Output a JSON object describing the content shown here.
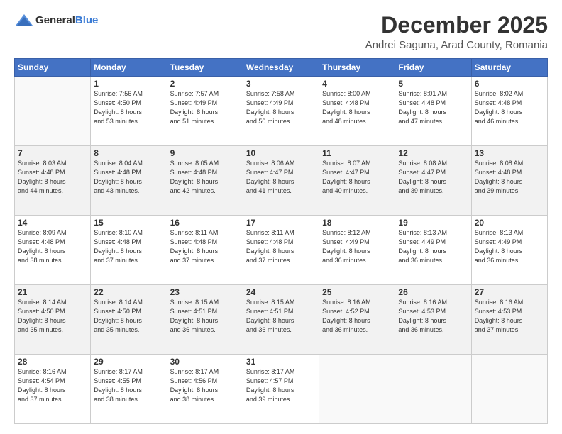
{
  "logo": {
    "general": "General",
    "blue": "Blue"
  },
  "title": "December 2025",
  "subtitle": "Andrei Saguna, Arad County, Romania",
  "header_days": [
    "Sunday",
    "Monday",
    "Tuesday",
    "Wednesday",
    "Thursday",
    "Friday",
    "Saturday"
  ],
  "weeks": [
    {
      "shaded": false,
      "days": [
        {
          "num": "",
          "info": ""
        },
        {
          "num": "1",
          "info": "Sunrise: 7:56 AM\nSunset: 4:50 PM\nDaylight: 8 hours\nand 53 minutes."
        },
        {
          "num": "2",
          "info": "Sunrise: 7:57 AM\nSunset: 4:49 PM\nDaylight: 8 hours\nand 51 minutes."
        },
        {
          "num": "3",
          "info": "Sunrise: 7:58 AM\nSunset: 4:49 PM\nDaylight: 8 hours\nand 50 minutes."
        },
        {
          "num": "4",
          "info": "Sunrise: 8:00 AM\nSunset: 4:48 PM\nDaylight: 8 hours\nand 48 minutes."
        },
        {
          "num": "5",
          "info": "Sunrise: 8:01 AM\nSunset: 4:48 PM\nDaylight: 8 hours\nand 47 minutes."
        },
        {
          "num": "6",
          "info": "Sunrise: 8:02 AM\nSunset: 4:48 PM\nDaylight: 8 hours\nand 46 minutes."
        }
      ]
    },
    {
      "shaded": true,
      "days": [
        {
          "num": "7",
          "info": "Sunrise: 8:03 AM\nSunset: 4:48 PM\nDaylight: 8 hours\nand 44 minutes."
        },
        {
          "num": "8",
          "info": "Sunrise: 8:04 AM\nSunset: 4:48 PM\nDaylight: 8 hours\nand 43 minutes."
        },
        {
          "num": "9",
          "info": "Sunrise: 8:05 AM\nSunset: 4:48 PM\nDaylight: 8 hours\nand 42 minutes."
        },
        {
          "num": "10",
          "info": "Sunrise: 8:06 AM\nSunset: 4:47 PM\nDaylight: 8 hours\nand 41 minutes."
        },
        {
          "num": "11",
          "info": "Sunrise: 8:07 AM\nSunset: 4:47 PM\nDaylight: 8 hours\nand 40 minutes."
        },
        {
          "num": "12",
          "info": "Sunrise: 8:08 AM\nSunset: 4:47 PM\nDaylight: 8 hours\nand 39 minutes."
        },
        {
          "num": "13",
          "info": "Sunrise: 8:08 AM\nSunset: 4:48 PM\nDaylight: 8 hours\nand 39 minutes."
        }
      ]
    },
    {
      "shaded": false,
      "days": [
        {
          "num": "14",
          "info": "Sunrise: 8:09 AM\nSunset: 4:48 PM\nDaylight: 8 hours\nand 38 minutes."
        },
        {
          "num": "15",
          "info": "Sunrise: 8:10 AM\nSunset: 4:48 PM\nDaylight: 8 hours\nand 37 minutes."
        },
        {
          "num": "16",
          "info": "Sunrise: 8:11 AM\nSunset: 4:48 PM\nDaylight: 8 hours\nand 37 minutes."
        },
        {
          "num": "17",
          "info": "Sunrise: 8:11 AM\nSunset: 4:48 PM\nDaylight: 8 hours\nand 37 minutes."
        },
        {
          "num": "18",
          "info": "Sunrise: 8:12 AM\nSunset: 4:49 PM\nDaylight: 8 hours\nand 36 minutes."
        },
        {
          "num": "19",
          "info": "Sunrise: 8:13 AM\nSunset: 4:49 PM\nDaylight: 8 hours\nand 36 minutes."
        },
        {
          "num": "20",
          "info": "Sunrise: 8:13 AM\nSunset: 4:49 PM\nDaylight: 8 hours\nand 36 minutes."
        }
      ]
    },
    {
      "shaded": true,
      "days": [
        {
          "num": "21",
          "info": "Sunrise: 8:14 AM\nSunset: 4:50 PM\nDaylight: 8 hours\nand 35 minutes."
        },
        {
          "num": "22",
          "info": "Sunrise: 8:14 AM\nSunset: 4:50 PM\nDaylight: 8 hours\nand 35 minutes."
        },
        {
          "num": "23",
          "info": "Sunrise: 8:15 AM\nSunset: 4:51 PM\nDaylight: 8 hours\nand 36 minutes."
        },
        {
          "num": "24",
          "info": "Sunrise: 8:15 AM\nSunset: 4:51 PM\nDaylight: 8 hours\nand 36 minutes."
        },
        {
          "num": "25",
          "info": "Sunrise: 8:16 AM\nSunset: 4:52 PM\nDaylight: 8 hours\nand 36 minutes."
        },
        {
          "num": "26",
          "info": "Sunrise: 8:16 AM\nSunset: 4:53 PM\nDaylight: 8 hours\nand 36 minutes."
        },
        {
          "num": "27",
          "info": "Sunrise: 8:16 AM\nSunset: 4:53 PM\nDaylight: 8 hours\nand 37 minutes."
        }
      ]
    },
    {
      "shaded": false,
      "days": [
        {
          "num": "28",
          "info": "Sunrise: 8:16 AM\nSunset: 4:54 PM\nDaylight: 8 hours\nand 37 minutes."
        },
        {
          "num": "29",
          "info": "Sunrise: 8:17 AM\nSunset: 4:55 PM\nDaylight: 8 hours\nand 38 minutes."
        },
        {
          "num": "30",
          "info": "Sunrise: 8:17 AM\nSunset: 4:56 PM\nDaylight: 8 hours\nand 38 minutes."
        },
        {
          "num": "31",
          "info": "Sunrise: 8:17 AM\nSunset: 4:57 PM\nDaylight: 8 hours\nand 39 minutes."
        },
        {
          "num": "",
          "info": ""
        },
        {
          "num": "",
          "info": ""
        },
        {
          "num": "",
          "info": ""
        }
      ]
    }
  ]
}
